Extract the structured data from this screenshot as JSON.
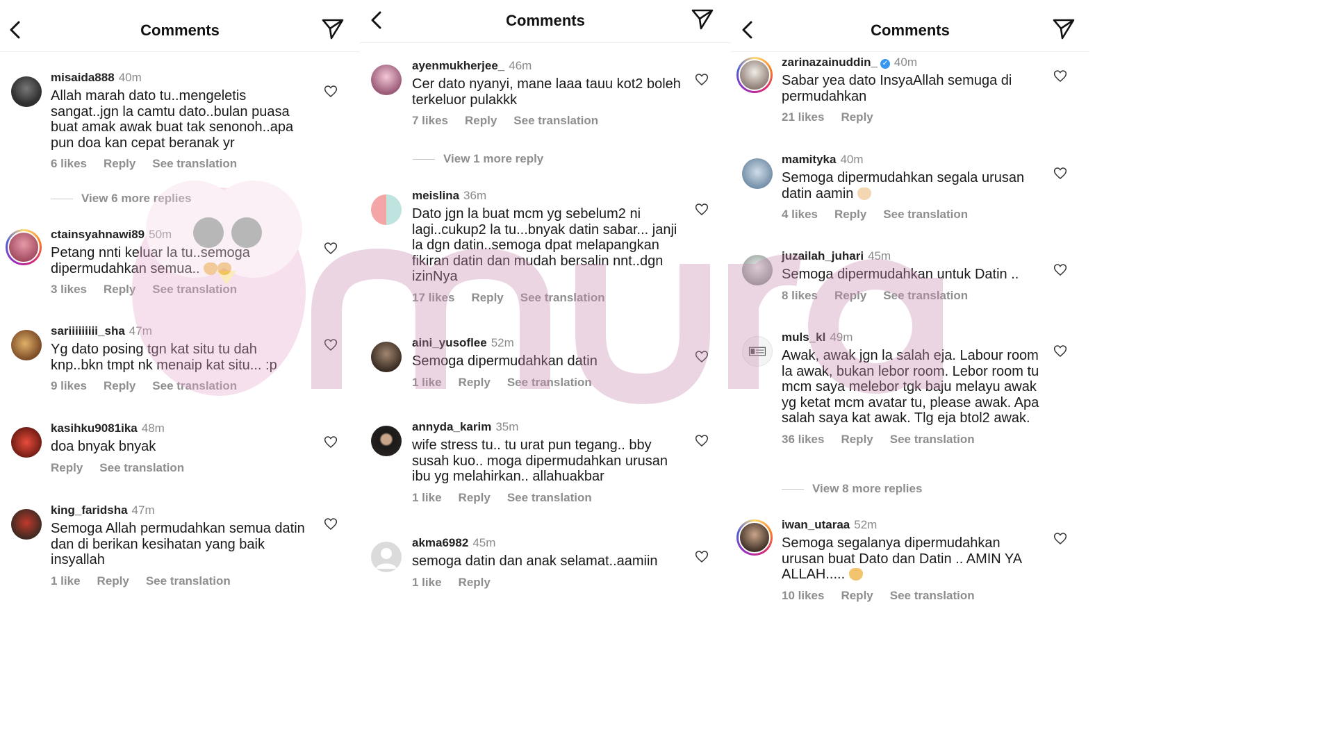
{
  "colors": {
    "muted": "#8e8e8e",
    "accent_verified": "#3897f0",
    "watermark": "#d6a8c8"
  },
  "icons": {
    "back": "chevron-left-icon",
    "send": "send-icon",
    "like": "heart-icon"
  },
  "panels": [
    {
      "title": "Comments",
      "comments": [
        {
          "username": "misaida888",
          "time": "40m",
          "text": "Allah marah dato tu..mengeletis sangat..jgn la camtu dato..bulan puasa buat amak awak buat tak senonoh..apa pun doa kan cepat beranak yr",
          "likes": "6 likes",
          "reply": "Reply",
          "translate": "See translation",
          "avatar": "#4a4a4a"
        },
        {
          "username": "ctainsyahnawi89",
          "time": "50m",
          "text": "Petang nnti keluar la tu..semoga dipermudahkan semua..",
          "likes": "3 likes",
          "reply": "Reply",
          "translate": "See translation",
          "avatar": "#b85a6a"
        },
        {
          "username": "sariiiiiiiii_sha",
          "time": "47m",
          "text": "Yg dato posing tgn kat situ tu dah knp..bkn tmpt nk menaip kat situ... :p",
          "likes": "9 likes",
          "reply": "Reply",
          "translate": "See translation",
          "avatar": "#8a5a3a"
        },
        {
          "username": "kasihku9081ika",
          "time": "48m",
          "text": "doa bnyak bnyak",
          "likes": "",
          "reply": "Reply",
          "translate": "See translation",
          "avatar": "#c0392b"
        },
        {
          "username": "king_faridsha",
          "time": "47m",
          "text": "Semoga Allah permudahkan semua datin dan di berikan kesihatan yang baik insyallah",
          "likes": "1 like",
          "reply": "Reply",
          "translate": "See translation",
          "avatar": "#6b4a3a"
        }
      ],
      "view_more": "View 6 more replies"
    },
    {
      "title": "Comments",
      "comments": [
        {
          "username": "ayenmukherjee_",
          "time": "46m",
          "text": "Cer dato nyanyi, mane laaa tauu kot2 boleh terkeluor pulakkk",
          "likes": "7 likes",
          "reply": "Reply",
          "translate": "See translation",
          "avatar": "#c58aa0"
        },
        {
          "username": "meislina",
          "time": "36m",
          "text": "Dato jgn la buat mcm yg sebelum2 ni lagi..cukup2 la tu...bnyak datin sabar... janji la dgn datin..semoga dpat melapangkan fikiran datin dan mudah bersalin nnt..dgn izinNya",
          "likes": "17 likes",
          "reply": "Reply",
          "translate": "See translation",
          "avatar": "#f1a7a7"
        },
        {
          "username": "aini_yusoflee",
          "time": "52m",
          "text": "Semoga dipermudahkan datin",
          "likes": "1 like",
          "reply": "Reply",
          "translate": "See translation",
          "avatar": "#5a4636"
        },
        {
          "username": "annyda_karim",
          "time": "35m",
          "text": "wife stress tu.. tu urat pun tegang.. bby susah kuo.. moga dipermudahkan urusan ibu yg melahirkan.. allahuakbar",
          "likes": "1 like",
          "reply": "Reply",
          "translate": "See translation",
          "avatar": "#2f2a28"
        },
        {
          "username": "akma6982",
          "time": "45m",
          "text": "semoga datin dan anak selamat..aamiin",
          "likes": "1 like",
          "reply": "Reply",
          "translate": "",
          "avatar": "#dcdcdc"
        }
      ],
      "view_more": "View 1 more reply"
    },
    {
      "title": "Comments",
      "comments": [
        {
          "username": "zarinazainuddin_",
          "time": "40m",
          "text": "Sabar yea dato  InsyaAllah semuga di permudahkan",
          "likes": "21 likes",
          "reply": "Reply",
          "translate": "",
          "avatar": "#9c8b86"
        },
        {
          "username": "mamityka",
          "time": "40m",
          "text": "Semoga dipermudahkan segala urusan datin aamin",
          "likes": "4 likes",
          "reply": "Reply",
          "translate": "See translation",
          "avatar": "#8fa6b8"
        },
        {
          "username": "juzailah_juhari",
          "time": "45m",
          "text": "Semoga dipermudahkan untuk Datin ..",
          "likes": "8 likes",
          "reply": "Reply",
          "translate": "See translation",
          "avatar": "#9aa5a0"
        },
        {
          "username": "muls_kl",
          "time": "49m",
          "text": "Awak, awak jgn la salah eja. Labour room la awak, bukan lebor room. Lebor room tu mcm saya melebor tgk baju melayu awak yg ketat mcm avatar tu, please awak. Apa salah saya kat awak. Tlg eja btol2 awak.",
          "likes": "36 likes",
          "reply": "Reply",
          "translate": "See translation",
          "avatar": "#eeeeee"
        },
        {
          "username": "iwan_utaraa",
          "time": "52m",
          "text": "Semoga segalanya dipermudahkan urusan buat Dato dan Datin .. AMIN YA ALLAH.....",
          "likes": "10 likes",
          "reply": "Reply",
          "translate": "See translation",
          "avatar": "#5b4a3e"
        }
      ],
      "view_more": "View 8 more replies"
    }
  ]
}
